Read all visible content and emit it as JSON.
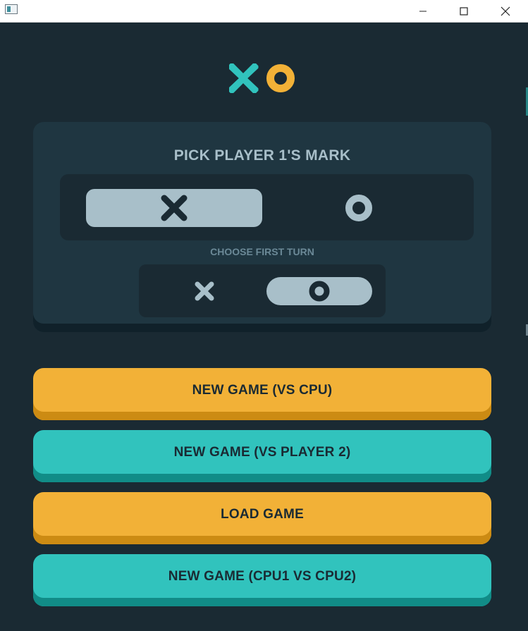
{
  "colors": {
    "background": "#1a2a33",
    "panel": "#1f3641",
    "silver": "#a8bfc9",
    "muted_label": "#6b8997",
    "teal": "#31c3bd",
    "teal_shadow": "#118c87",
    "yellow": "#f2b137",
    "yellow_shadow": "#cc8b13"
  },
  "window": {
    "controls": [
      "minimize-icon",
      "maximize-icon",
      "close-icon"
    ]
  },
  "logo": {
    "icons": [
      "x-mark-icon",
      "o-mark-icon"
    ]
  },
  "setup": {
    "title": "PICK PLAYER 1'S MARK",
    "mark_options": [
      "x-mark-icon",
      "o-mark-icon"
    ],
    "selected_mark": "X",
    "first_turn_label": "CHOOSE FIRST TURN",
    "turn_options": [
      "x-mark-icon",
      "o-mark-icon"
    ],
    "selected_first_turn": "O"
  },
  "buttons": {
    "new_game_cpu": "NEW GAME (VS CPU)",
    "new_game_player": "NEW GAME (VS PLAYER 2)",
    "load_game": "LOAD GAME",
    "new_game_cpu_vs_cpu": "NEW GAME (CPU1 VS CPU2)"
  }
}
